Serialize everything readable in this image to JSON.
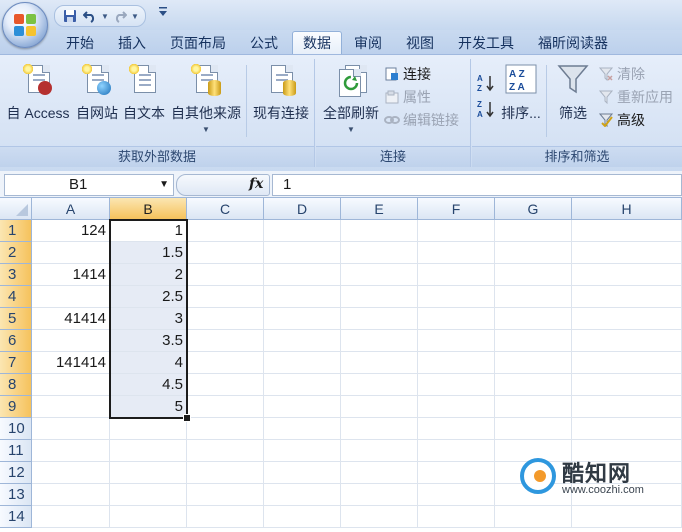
{
  "quick_access": {
    "save_icon": "save-icon",
    "undo_icon": "undo-icon",
    "redo_icon": "redo-icon",
    "customize_icon": "customize-icon"
  },
  "tabs": [
    "开始",
    "插入",
    "页面布局",
    "公式",
    "数据",
    "审阅",
    "视图",
    "开发工具",
    "福昕阅读器"
  ],
  "active_tab": "数据",
  "ribbon": {
    "group_external": {
      "label": "获取外部数据",
      "buttons": [
        "自 Access",
        "自网站",
        "自文本",
        "自其他来源",
        "现有连接"
      ]
    },
    "group_connections": {
      "label": "连接",
      "refresh_all": "全部刷新",
      "connections": "连接",
      "properties": "属性",
      "edit_links": "编辑链接"
    },
    "group_sort": {
      "label": "排序和筛选",
      "sort": "排序...",
      "filter": "筛选",
      "clear": "清除",
      "reapply": "重新应用",
      "advanced": "高级"
    }
  },
  "formula_bar": {
    "name_box": "B1",
    "fx": "fx",
    "content": "1"
  },
  "sheet": {
    "columns": [
      "A",
      "B",
      "C",
      "D",
      "E",
      "F",
      "G",
      "H"
    ],
    "rows": [
      "1",
      "2",
      "3",
      "4",
      "5",
      "6",
      "7",
      "8",
      "9",
      "10",
      "11",
      "12",
      "13",
      "14"
    ],
    "selected_column": "B",
    "col_a": [
      "124",
      "",
      "1414",
      "",
      "41414",
      "",
      "141414",
      "",
      "",
      "",
      "",
      "",
      "",
      ""
    ],
    "col_b": [
      "1",
      "1.5",
      "2",
      "2.5",
      "3",
      "3.5",
      "4",
      "4.5",
      "5",
      "",
      "",
      "",
      "",
      ""
    ]
  },
  "watermark": {
    "title": "酷知网",
    "url": "www.coozhi.com"
  }
}
